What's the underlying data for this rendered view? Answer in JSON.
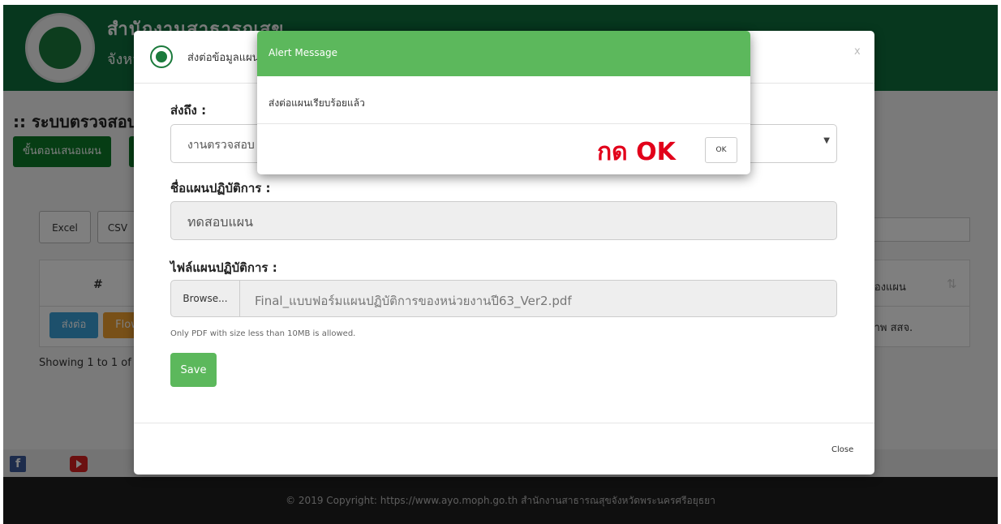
{
  "background": {
    "header_title": "สำนักงานสาธารณสุข",
    "header_subtitle": "จังหวัด",
    "system_title": ":: ระบบตรวจสอบแ",
    "step_button": "ขั้นตอนเสนอแผน",
    "export_buttons": [
      "Excel",
      "CSV"
    ],
    "table_header_hash": "#",
    "table_header_right": "ของแผน",
    "row_button_send": "ส่งต่อ",
    "row_button_flow": "Flow",
    "row_right_value": "ภาพ สสจ.",
    "showing_text": "Showing 1 to 1 of",
    "footer_text": "© 2019 Copyright: https://www.ayo.moph.go.th สำนักงานสาธารณสุขจังหวัดพระนครศรีอยุธยา"
  },
  "modal": {
    "title": "ส่งต่อข้อมูลแผน",
    "close_x": "x",
    "send_to_label": "ส่งถึง :",
    "send_to_value": "งานตรวจสอบ",
    "plan_name_label": "ชื่อแผนปฏิบัติการ :",
    "plan_name_value": "ทดสอบแผน",
    "plan_file_label": "ไฟล์แผนปฏิบัติการ :",
    "browse_label": "Browse...",
    "file_name": "Final_แบบฟอร์มแผนปฏิบัติการของหน่วยงานปี63_Ver2.pdf",
    "help_text": "Only PDF with size less than 10MB is allowed.",
    "save_label": "Save",
    "close_label": "Close"
  },
  "alert": {
    "title": "Alert Message",
    "message": "ส่งต่อแผนเรียบร้อยแล้ว",
    "hint": "กด OK",
    "ok_label": "OK"
  },
  "colors": {
    "header_green": "#0f6e3d",
    "alert_green": "#5cb85c",
    "hint_red": "#e2001a"
  }
}
